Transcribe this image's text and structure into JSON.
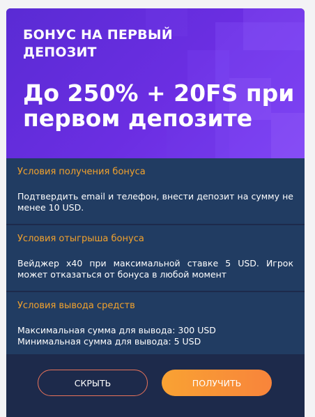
{
  "banner": {
    "subtitle": "БОНУС НА ПЕРВЫЙ ДЕПОЗИТ",
    "title": "До 250% + 20FS при первом депозите"
  },
  "sections": [
    {
      "title": "Условия получения бонуса",
      "text": "Подтвердить email и телефон, внести депозит на сумму не менее 10 USD."
    },
    {
      "title": "Условия отыгрыша бонуса",
      "text": "Вейджер x40 при максимальной ставке 5 USD. Игрок может отказаться от бонуса в любой момент"
    },
    {
      "title": "Условия вывода средств",
      "line1": "Максимальная сумма для вывода: 300 USD",
      "line2": "Минимальная сумма для вывода: 5 USD"
    }
  ],
  "buttons": {
    "hide": "СКРЫТЬ",
    "get": "ПОЛУЧИТЬ"
  },
  "colors": {
    "banner_purple": "#6b2ee2",
    "section_bg": "#213c62",
    "card_bg": "#1d2a4b",
    "heading_orange": "#f2a22d",
    "button_orange": "#f8843b",
    "hide_border": "#e8735a"
  }
}
